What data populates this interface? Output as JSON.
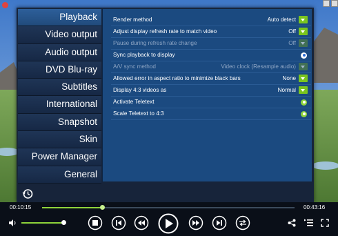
{
  "sidebar": {
    "items": [
      {
        "label": "Playback",
        "active": true
      },
      {
        "label": "Video output",
        "active": false
      },
      {
        "label": "Audio output",
        "active": false
      },
      {
        "label": "DVD  Blu-ray",
        "active": false
      },
      {
        "label": "Subtitles",
        "active": false
      },
      {
        "label": "International",
        "active": false
      },
      {
        "label": "Snapshot",
        "active": false
      },
      {
        "label": "Skin",
        "active": false
      },
      {
        "label": "Power Manager",
        "active": false
      },
      {
        "label": "General",
        "active": false
      }
    ]
  },
  "settings": [
    {
      "label": "Render method",
      "value": "Auto detect",
      "control": "dropdown",
      "enabled": true
    },
    {
      "label": "Adjust display refresh rate to match video",
      "value": "Off",
      "control": "dropdown",
      "enabled": true
    },
    {
      "label": "Pause during refresh rate change",
      "value": "Off",
      "control": "dropdown",
      "enabled": false
    },
    {
      "label": "Sync playback to display",
      "value": "",
      "control": "radio-blue",
      "enabled": true
    },
    {
      "label": "A/V sync method",
      "value": "Video clock (Resample audio)",
      "control": "dropdown",
      "enabled": false
    },
    {
      "label": "Allowed error in aspect ratio to minimize black bars",
      "value": "None",
      "control": "dropdown",
      "enabled": true
    },
    {
      "label": "Display 4:3 videos as",
      "value": "Normal",
      "control": "dropdown",
      "enabled": true
    },
    {
      "label": "Activate Teletext",
      "value": "",
      "control": "radio-green",
      "enabled": true
    },
    {
      "label": "Scale Teletext to 4:3",
      "value": "",
      "control": "radio-green",
      "enabled": true
    }
  ],
  "player": {
    "elapsed": "00:10:15",
    "duration": "00:43:16",
    "seek_fraction": 0.24,
    "volume_fraction": 0.95
  },
  "icons": {
    "history": "history-icon",
    "volume": "speaker-icon",
    "stop": "stop-icon",
    "prev": "skip-previous-icon",
    "rewind": "rewind-icon",
    "play": "play-icon",
    "forward": "fast-forward-icon",
    "next": "skip-next-icon",
    "repeat": "repeat-icon",
    "share": "share-icon",
    "playlist": "playlist-icon",
    "fullscreen": "fullscreen-icon"
  },
  "colors": {
    "accent": "#8fd43a",
    "panel": "#1b4a80",
    "sidebar_active": "#2d5f9a"
  }
}
